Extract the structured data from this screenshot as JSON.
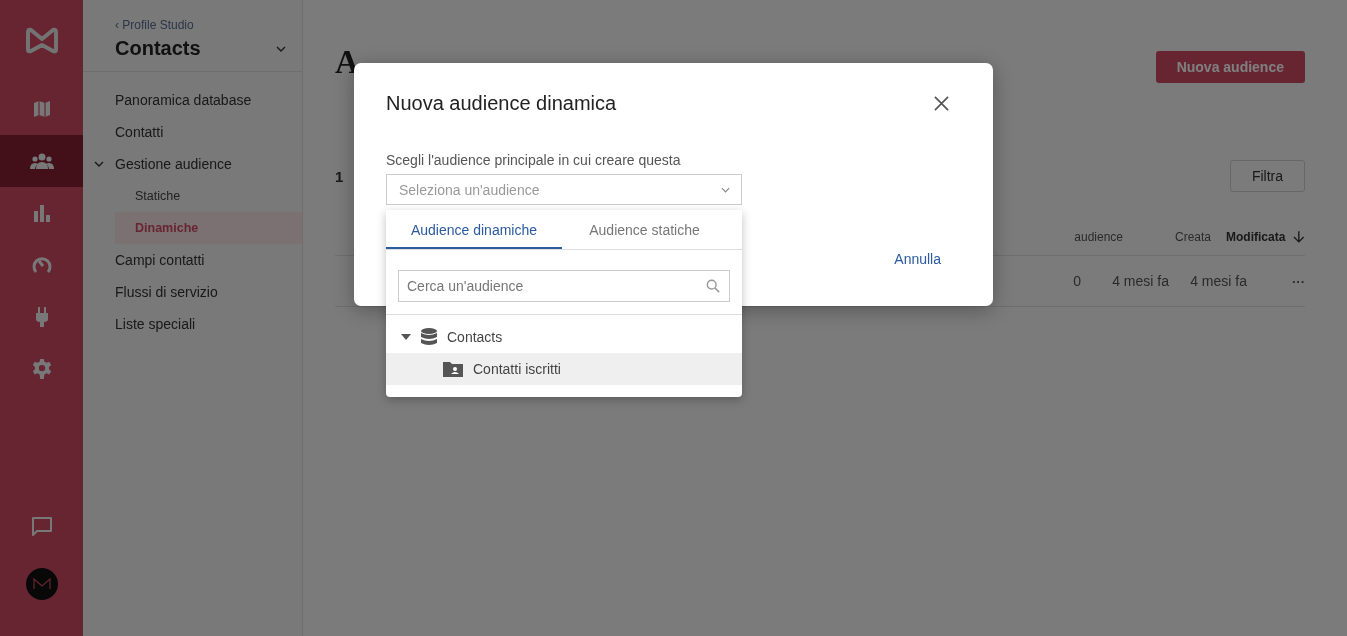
{
  "rail": {
    "items": [
      {
        "selected": false
      },
      {
        "selected": true
      },
      {
        "selected": false
      },
      {
        "selected": false
      },
      {
        "selected": false
      },
      {
        "selected": false
      }
    ]
  },
  "panel": {
    "back_link": "Profile Studio",
    "back_icon": "‹",
    "title": "Contacts",
    "nav": [
      {
        "label": "Panoramica database",
        "selected": false
      },
      {
        "label": "Contatti",
        "selected": false
      },
      {
        "label": "Gestione audience",
        "selected": false,
        "expanded": true,
        "children": [
          {
            "label": "Statiche",
            "selected": false
          },
          {
            "label": "Dinamiche",
            "selected": true
          }
        ]
      },
      {
        "label": "Campi contatti",
        "selected": false
      },
      {
        "label": "Flussi di servizio",
        "selected": false
      },
      {
        "label": "Liste speciali",
        "selected": false
      }
    ]
  },
  "main": {
    "title": "A",
    "new_button": "Nuova audience",
    "count": "1",
    "filter_button": "Filtra",
    "table": {
      "columns": [
        {
          "label": "audience",
          "sorted": false
        },
        {
          "label": "Creata",
          "sorted": false
        },
        {
          "label": "Modificata",
          "sorted": true
        }
      ],
      "rows": [
        {
          "cells": [
            "0",
            "4 mesi fa",
            "4 mesi fa"
          ],
          "menu": "···"
        }
      ]
    }
  },
  "modal": {
    "title": "Nuova audience dinamica",
    "field_label": "Scegli l'audience principale in cui creare questa",
    "select": {
      "placeholder": "Seleziona un'audience"
    },
    "cancel": "Annulla",
    "dropdown": {
      "tabs": [
        {
          "label": "Audience dinamiche",
          "selected": true
        },
        {
          "label": "Audience statiche",
          "selected": false
        }
      ],
      "search": {
        "placeholder": "Cerca un'audience"
      },
      "tree": [
        {
          "label": "Contacts",
          "expanded": true,
          "highlighted": false,
          "children": [
            {
              "label": "Contatti iscritti",
              "highlighted": true
            }
          ]
        }
      ]
    }
  }
}
